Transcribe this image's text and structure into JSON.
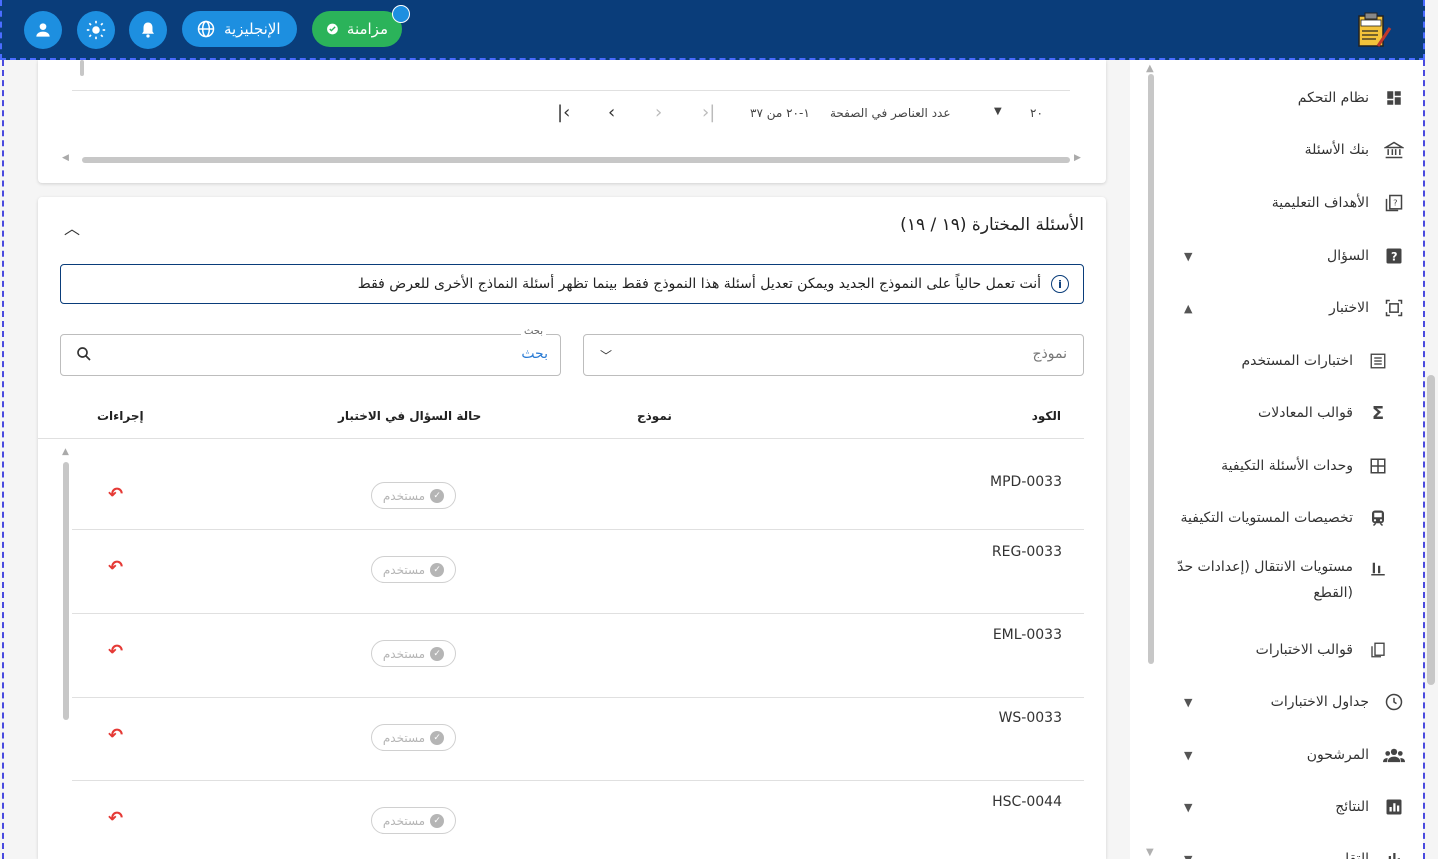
{
  "topbar": {
    "sync_label": "مزامنة",
    "language_label": "الإنجليزية",
    "colors": {
      "bar": "#0a3d7a",
      "accent": "#1d8fe0",
      "sync": "#2bb35a"
    }
  },
  "sidebar": {
    "items": [
      {
        "label": "نظام التحكم",
        "icon": "dashboard-icon"
      },
      {
        "label": "بنك الأسئلة",
        "icon": "bank-icon"
      },
      {
        "label": "الأهداف التعليمية",
        "icon": "objectives-icon"
      },
      {
        "label": "السؤال",
        "icon": "question-icon",
        "expandable": true,
        "expanded": false
      },
      {
        "label": "الاختبار",
        "icon": "exam-icon",
        "expandable": true,
        "expanded": true
      },
      {
        "label": "اختبارات المستخدم",
        "icon": "list-icon",
        "sub": true
      },
      {
        "label": "قوالب المعادلات",
        "icon": "sigma-icon",
        "sub": true
      },
      {
        "label": "وحدات الأسئلة التكيفية",
        "icon": "grid-icon",
        "sub": true
      },
      {
        "label": "تخصيصات المستويات التكيفية",
        "icon": "transit-icon",
        "sub": true
      },
      {
        "label": "مستويات الانتقال (إعدادات حدّ",
        "label2": "القطع)",
        "icon": "bar-chart-icon",
        "sub": true
      },
      {
        "label": "قوالب الاختبارات",
        "icon": "template-icon",
        "sub": true
      },
      {
        "label": "جداول الاختبارات",
        "icon": "clock-icon",
        "expandable": true
      },
      {
        "label": "المرشحون",
        "icon": "people-icon",
        "expandable": true
      },
      {
        "label": "النتائج",
        "icon": "results-icon",
        "expandable": true
      },
      {
        "label": "التقارير",
        "icon": "report-icon",
        "expandable": true
      }
    ]
  },
  "pager": {
    "page_size": "٢٠",
    "page_size_label": "عدد العناصر في الصفحة",
    "range": "١-٢٠ من ٣٧"
  },
  "selected": {
    "title": "الأسئلة المختارة (١٩ / ١٩)",
    "info": "أنت تعمل حالياً على النموذج الجديد ويمكن تعديل أسئلة هذا النموذج فقط بينما تظهر أسئلة النماذج الأخرى للعرض فقط",
    "model_placeholder": "نموذج",
    "search_label": "بحث",
    "search_value": "بحث",
    "columns": {
      "code": "الكود",
      "model": "نموذج",
      "status": "حالة السؤال في الاختبار",
      "actions": "إجراءات"
    },
    "rows": [
      {
        "code": "MPD-0033",
        "status": "مستخدم"
      },
      {
        "code": "REG-0033",
        "status": "مستخدم"
      },
      {
        "code": "EML-0033",
        "status": "مستخدم"
      },
      {
        "code": "WS-0033",
        "status": "مستخدم"
      },
      {
        "code": "HSC-0044",
        "status": "مستخدم"
      }
    ]
  }
}
